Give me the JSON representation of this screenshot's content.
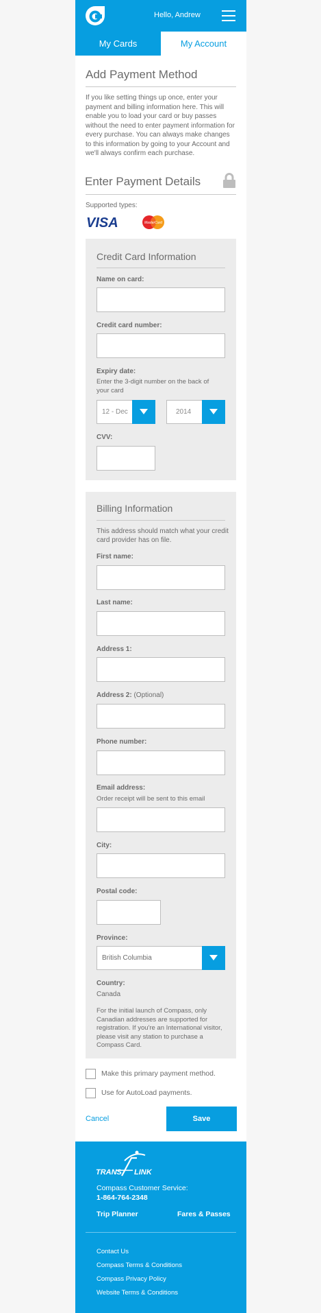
{
  "header": {
    "greeting": "Hello, Andrew",
    "logo_icon": "compass-logo-icon",
    "menu_icon": "hamburger-menu-icon"
  },
  "tabs": [
    {
      "label": "My Cards",
      "active": false
    },
    {
      "label": "My Account",
      "active": true
    }
  ],
  "main": {
    "title": "Add Payment Method",
    "intro": "If you like setting things up once, enter your payment and billing information here. This will enable you to load your card or buy passes without the need to enter payment information for every purchase. You can always make changes to this information by going to your Account and we'll always confirm each purchase.",
    "section_title": "Enter Payment Details",
    "supported_label": "Supported types:",
    "card_types": [
      "VISA",
      "MasterCard"
    ]
  },
  "credit_card": {
    "title": "Credit Card Information",
    "name_label": "Name on card:",
    "number_label": "Credit card number:",
    "expiry_label": "Expiry date:",
    "expiry_hint": "Enter the 3-digit number on the back of your card",
    "expiry_month": "12 - Dec",
    "expiry_year": "2014",
    "cvv_label": "CVV:"
  },
  "billing": {
    "title": "Billing Information",
    "intro": "This address should match what your credit card provider has on file.",
    "first_name_label": "First name:",
    "last_name_label": "Last name:",
    "address1_label": "Address 1:",
    "address2_label": "Address 2:",
    "address2_optional": "(Optional)",
    "phone_label": "Phone number:",
    "email_label": "Email address:",
    "email_hint": "Order receipt will be sent to this email",
    "city_label": "City:",
    "postal_label": "Postal code:",
    "province_label": "Province:",
    "province_value": "British Columbia",
    "country_label": "Country:",
    "country_value": "Canada",
    "note": "For the initial launch of Compass, only Canadian addresses are supported for registration. If you're an International visitor, please visit any station to purchase a Compass Card."
  },
  "options": {
    "primary_label": "Make this primary payment method.",
    "autoload_label": "Use for AutoLoad payments."
  },
  "actions": {
    "cancel_label": "Cancel",
    "save_label": "Save"
  },
  "footer": {
    "logo_text_left": "TRANS",
    "logo_text_right": "LINK",
    "service_label": "Compass Customer Service:",
    "phone": "1-864-764-2348",
    "trip_planner": "Trip Planner",
    "fares": "Fares & Passes",
    "links": [
      "Contact Us",
      "Compass Terms & Conditions",
      "Compass Privacy Policy",
      "Website Terms & Conditions"
    ]
  },
  "colors": {
    "brand_blue": "#079ee0",
    "panel_gray": "#ececec",
    "text_gray": "#6b6b6b"
  }
}
